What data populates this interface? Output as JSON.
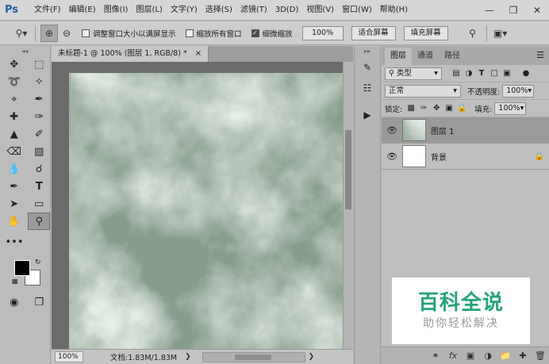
{
  "app": {
    "logo": "Ps"
  },
  "menu": [
    "文件(F)",
    "编辑(E)",
    "图像(I)",
    "图层(L)",
    "文字(Y)",
    "选择(S)",
    "滤镜(T)",
    "3D(D)",
    "视图(V)",
    "窗口(W)",
    "帮助(H)"
  ],
  "options": {
    "resize_windows_label": "调整窗口大小以满屏显示",
    "resize_windows_checked": false,
    "zoom_all_label": "缩放所有窗口",
    "zoom_all_checked": false,
    "scrubby_label": "细微缩放",
    "scrubby_checked": true,
    "zoom_value": "100%",
    "fit_screen": "适合屏幕",
    "fill_screen": "填充屏幕"
  },
  "document": {
    "tab_title": "未标题-1 @ 100% (图层 1, RGB/8) *",
    "close": "×",
    "status_zoom": "100%",
    "status_info": "文档:1.83M/1.83M"
  },
  "layers_panel": {
    "tabs": [
      "图层",
      "通道",
      "路径"
    ],
    "filter_type": "类型",
    "blend_mode": "正常",
    "opacity_label": "不透明度:",
    "opacity_value": "100%",
    "lock_label": "锁定:",
    "fill_label": "填充:",
    "fill_value": "100%",
    "layers": [
      {
        "name": "图层 1",
        "visible": true,
        "active": true,
        "locked": false
      },
      {
        "name": "背景",
        "visible": true,
        "active": false,
        "locked": true
      }
    ]
  },
  "watermark": {
    "main": "百科全说",
    "sub": "助你轻松解决"
  },
  "colors": {
    "accent_watermark": "#24a37b",
    "foreground": "#000000",
    "background": "#ffffff"
  }
}
